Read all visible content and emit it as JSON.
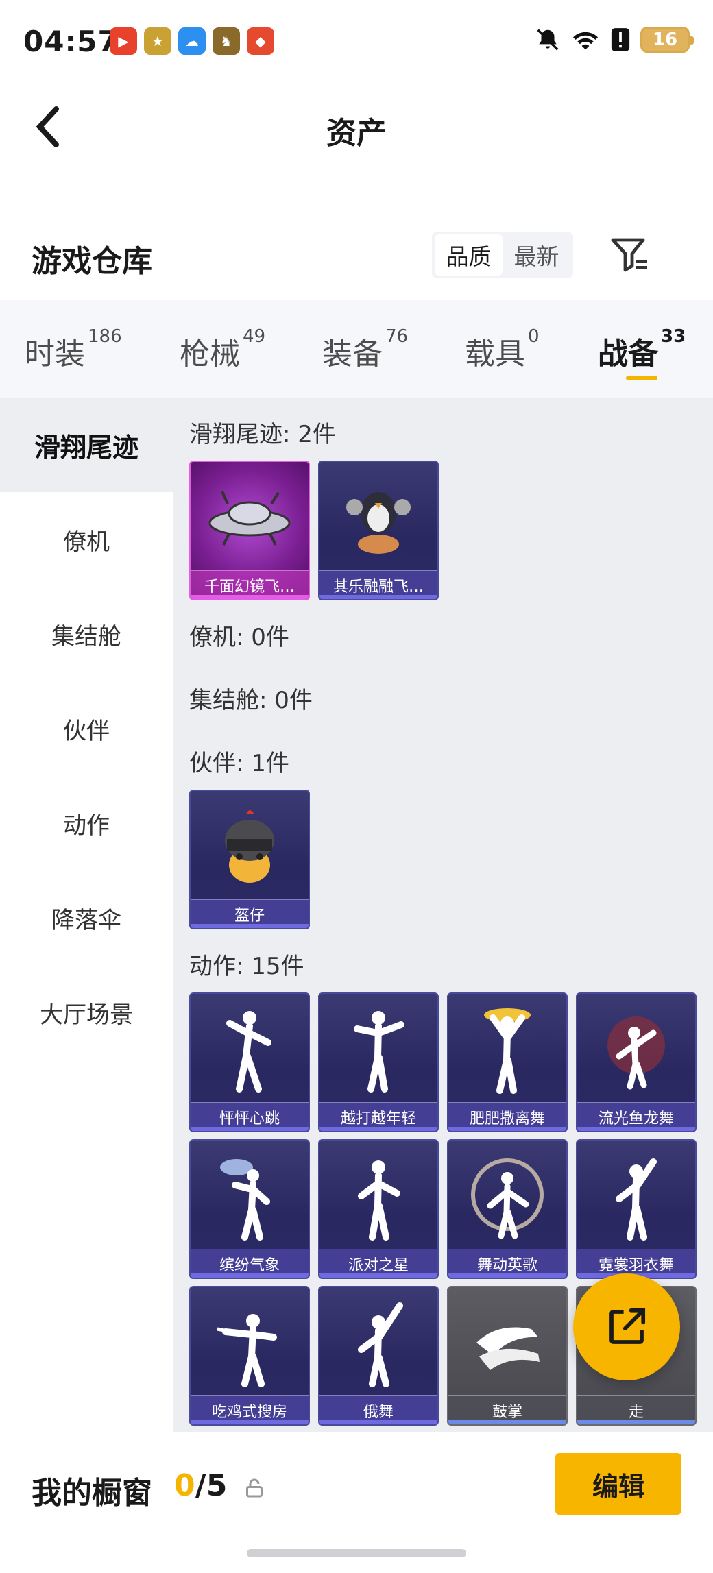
{
  "status_bar": {
    "time": "04:57",
    "battery": "16",
    "app_icons": [
      "video-app-icon",
      "game-news-app-icon",
      "weather-app-icon",
      "game-app-icon",
      "security-app-icon"
    ],
    "right_icons": [
      "bell-mute-icon",
      "wifi-icon",
      "alert-icon",
      "battery-icon"
    ]
  },
  "header": {
    "title": "资产"
  },
  "section": {
    "title": "游戏仓库",
    "sort_options": [
      "品质",
      "最新"
    ],
    "sort_active": "品质"
  },
  "tabs": [
    {
      "label": "时装",
      "count": "186"
    },
    {
      "label": "枪械",
      "count": "49"
    },
    {
      "label": "装备",
      "count": "76"
    },
    {
      "label": "载具",
      "count": "0"
    },
    {
      "label": "战备",
      "count": "33",
      "active": true
    }
  ],
  "sidebar": {
    "items": [
      "滑翔尾迹",
      "僚机",
      "集结舱",
      "伙伴",
      "动作",
      "降落伞",
      "大厅场景"
    ],
    "active": "滑翔尾迹"
  },
  "groups": {
    "glide": {
      "label": "滑翔尾迹: 2件",
      "items": [
        "千面幻镜飞…",
        "其乐融融飞…"
      ]
    },
    "wingman": {
      "label": "僚机: 0件"
    },
    "capsule": {
      "label": "集结舱: 0件"
    },
    "partner": {
      "label": "伙伴: 1件",
      "items": [
        "盔仔"
      ]
    },
    "action": {
      "label": "动作: 15件",
      "items": [
        "怦怦心跳",
        "越打越年轻",
        "肥肥撒离舞",
        "流光鱼龙舞",
        "缤纷气象",
        "派对之星",
        "舞动英歌",
        "霓裳羽衣舞",
        "吃鸡式搜房",
        "俄舞",
        "鼓掌",
        "走"
      ]
    }
  },
  "bottom": {
    "label": "我的橱窗",
    "count_current": "0",
    "count_total": "/5",
    "edit_label": "编辑"
  },
  "colors": {
    "accent": "#f7b500",
    "card_purple": "#2a2860",
    "card_pink": "#7a1f92",
    "card_gray": "#47474d"
  }
}
